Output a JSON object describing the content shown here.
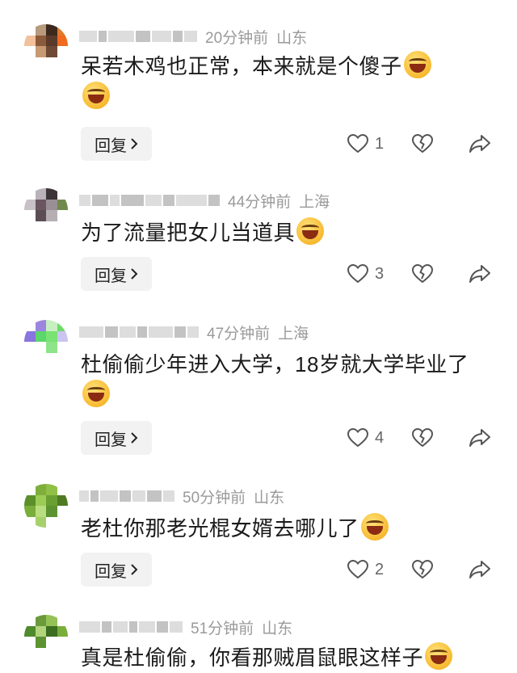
{
  "reply_label": "回复",
  "comments": [
    {
      "time": "20分钟前",
      "location": "山东",
      "text": "呆若木鸡也正常，本来就是个傻子",
      "likes": "1",
      "avatar_colors": [
        "#ffffff",
        "#b89a7c",
        "#3d2a1e",
        "#e07a2c",
        "#f3c09c",
        "#8a5a3b",
        "#5a3a2a",
        "#f06b1f",
        "#ffffff",
        "#c89a72",
        "#6e4a36",
        "#ffffff",
        "#ffffff",
        "#ffffff",
        "#ffffff",
        "#ffffff"
      ]
    },
    {
      "time": "44分钟前",
      "location": "上海",
      "text": "为了流量把女儿当道具",
      "likes": "3",
      "avatar_colors": [
        "#ffffff",
        "#b9b2b8",
        "#3b3438",
        "#ffffff",
        "#c8c1c6",
        "#6a5560",
        "#9b8f96",
        "#6f8a4c",
        "#ffffff",
        "#5c4d55",
        "#b7aeb4",
        "#ffffff",
        "#ffffff",
        "#ffffff",
        "#ffffff",
        "#ffffff"
      ]
    },
    {
      "time": "47分钟前",
      "location": "上海",
      "text": "杜偷偷少年进入大学，18岁就大学毕业了",
      "likes": "4",
      "avatar_colors": [
        "#ffffff",
        "#9d86e0",
        "#c7f0c0",
        "#6fdc6a",
        "#8a74dd",
        "#5bd66b",
        "#7be274",
        "#c9c4f0",
        "#ffffff",
        "#ffffff",
        "#8ee489",
        "#ffffff",
        "#ffffff",
        "#ffffff",
        "#ffffff",
        "#ffffff"
      ]
    },
    {
      "time": "50分钟前",
      "location": "山东",
      "text": "老杜你那老光棍女婿去哪儿了",
      "likes": "2",
      "avatar_colors": [
        "#ffffff",
        "#7fae3b",
        "#90c046",
        "#ffffff",
        "#5c8f2a",
        "#9ccc55",
        "#6aa032",
        "#4f7a22",
        "#7aae3a",
        "#b8de80",
        "#5d9431",
        "#ffffff",
        "#ffffff",
        "#a6d16a",
        "#ffffff",
        "#ffffff"
      ]
    },
    {
      "time": "51分钟前",
      "location": "山东",
      "text": "真是杜偷偷，你看那贼眉鼠眼这样子",
      "avatar_colors": [
        "#ffffff",
        "#6a9a3c",
        "#94c256",
        "#ffffff",
        "#4f8a2c",
        "#b1d47c",
        "#3b6e20",
        "#7aae3a",
        "#ffffff",
        "#5d9431",
        "#ffffff",
        "#ffffff",
        "#ffffff",
        "#ffffff",
        "#ffffff",
        "#ffffff"
      ]
    }
  ]
}
